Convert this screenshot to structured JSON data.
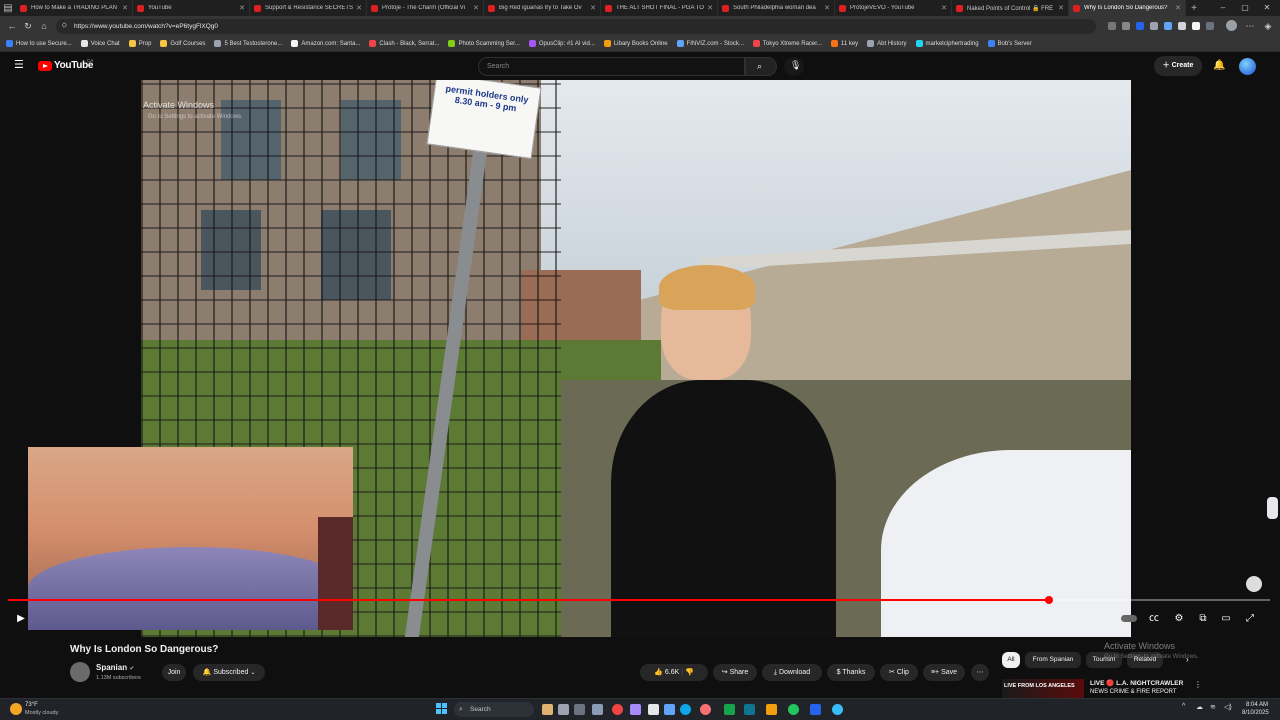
{
  "browser": {
    "tabs": [
      {
        "label": "How to Make a TRADING PLAN",
        "active": false
      },
      {
        "label": "YouTube",
        "active": false
      },
      {
        "label": "Support & Resistance SECRETS",
        "active": false
      },
      {
        "label": "Protoje - The Charm (Official Vi",
        "active": false
      },
      {
        "label": "Big Red iguanas try to Take Ov",
        "active": false
      },
      {
        "label": "THE ALT SHOT FINAL - PGA TO",
        "active": false
      },
      {
        "label": "South Philadelphia woman dea",
        "active": false
      },
      {
        "label": "ProtojeVEVO - YouTube",
        "active": false
      },
      {
        "label": "Naked Points of Control 🔒 FRE",
        "active": false
      },
      {
        "label": "Why Is London So Dangerous?",
        "active": true
      }
    ],
    "url": "https://www.youtube.com/watch?v=eP6tygFlXQg0",
    "bookmarks": [
      {
        "label": "How to use Secure...",
        "color": "#3b82f6"
      },
      {
        "label": "Voice Chat",
        "color": "#e5e7eb"
      },
      {
        "label": "Prop",
        "color": "#f5c542"
      },
      {
        "label": "Golf Courses",
        "color": "#f5c542"
      },
      {
        "label": "5 Best Testosterone...",
        "color": "#9ca3af"
      },
      {
        "label": "Amazon.com: Santa...",
        "color": "#f5f5f5"
      },
      {
        "label": "Clash - Black, Serrat...",
        "color": "#ef4444"
      },
      {
        "label": "Photo Scamming Ser...",
        "color": "#84cc16"
      },
      {
        "label": "OpusClip: #1 AI vid...",
        "color": "#a855f7"
      },
      {
        "label": "Libary Books Online",
        "color": "#f59e0b"
      },
      {
        "label": "FINVIZ.com - Stock...",
        "color": "#60a5fa"
      },
      {
        "label": "Tokyo Xtreme Racer...",
        "color": "#ef4444"
      },
      {
        "label": "11 key",
        "color": "#f97316"
      },
      {
        "label": "Abt History",
        "color": "#9ca3af"
      },
      {
        "label": "marketciphertrading",
        "color": "#22d3ee"
      },
      {
        "label": "Bob's Server",
        "color": "#3b82f6"
      }
    ]
  },
  "youtube": {
    "logo_text": "YouTube",
    "logo_region": "CA",
    "search_placeholder": "Search",
    "create_label": "Create",
    "watermark_line1": "Activate Windows",
    "watermark_line2": "Go to Settings to activate Windows.",
    "video": {
      "progress_pct": 82.5,
      "title": "Why Is London So Dangerous?",
      "channel": "Spanian",
      "subscribers": "1.13M subscribers",
      "join_label": "Join",
      "subscribed_label": "Subscribed",
      "likes": "6.6K",
      "share_label": "Share",
      "download_label": "Download",
      "thanks_label": "Thanks",
      "clip_label": "Clip",
      "save_label": "Save",
      "sign_text": "permit holders only 8.30 am - 9 pm"
    },
    "chips": [
      "All",
      "From Spanian",
      "Tourism",
      "Related"
    ],
    "recommendation": {
      "live_badge": "LIVE FROM LOS ANGELES",
      "title": "LIVE 🔴 L.A. NIGHTCRAWLER",
      "subtitle": "NEWS CRIME & FIRE REPORT"
    }
  },
  "taskbar": {
    "weather_temp": "73°F",
    "weather_desc": "Mostly cloudy",
    "search_label": "Search",
    "time": "8:04 AM",
    "date": "8/10/2025"
  },
  "colors": {
    "yt_red": "#ff0000",
    "bg": "#0f0f0f",
    "pill": "#272727"
  }
}
